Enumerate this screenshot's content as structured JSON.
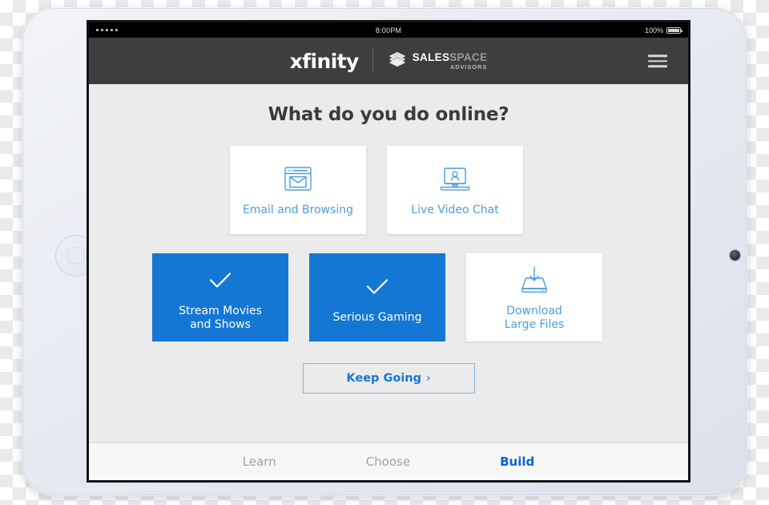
{
  "status_bar": {
    "signal_dots": 5,
    "time": "8:00PM",
    "battery_percent": "100%"
  },
  "header": {
    "xfinity_logo": "xfinity",
    "partner_logo": {
      "icon": "stacked-layers-icon",
      "name_primary": "SALES",
      "name_secondary": "SPACE",
      "subtitle": "ADVISORS"
    },
    "menu_icon": "hamburger-menu-icon"
  },
  "main": {
    "title": "What do you do online?",
    "options": [
      {
        "id": "email-and-browsing",
        "label": "Email and Browsing",
        "icon": "browser-envelope-icon",
        "selected": false
      },
      {
        "id": "live-video-chat",
        "label": "Live Video Chat",
        "icon": "laptop-person-icon",
        "selected": false
      },
      {
        "id": "stream-movies-and-shows",
        "label": "Stream Movies\nand Shows",
        "label_line1": "Stream Movies",
        "label_line2": "and Shows",
        "icon": "checkmark-icon",
        "selected": true
      },
      {
        "id": "serious-gaming",
        "label": "Serious Gaming",
        "icon": "checkmark-icon",
        "selected": true
      },
      {
        "id": "download-large-files",
        "label": "Download\nLarge Files",
        "label_line1": "Download",
        "label_line2": "Large Files",
        "icon": "download-drive-icon",
        "selected": false
      }
    ],
    "cta": {
      "label": "Keep Going",
      "chevron": "›"
    }
  },
  "bottom_nav": {
    "items": [
      {
        "label": "Learn",
        "active": false
      },
      {
        "label": "Choose",
        "active": false
      },
      {
        "label": "Build",
        "active": true
      }
    ]
  },
  "colors": {
    "accent_blue": "#1577d4",
    "icon_blue": "#4a9fe0",
    "nav_active_blue": "#0b62d6",
    "header_dark": "#3e3e3e",
    "screen_bg": "#ebebeb"
  }
}
